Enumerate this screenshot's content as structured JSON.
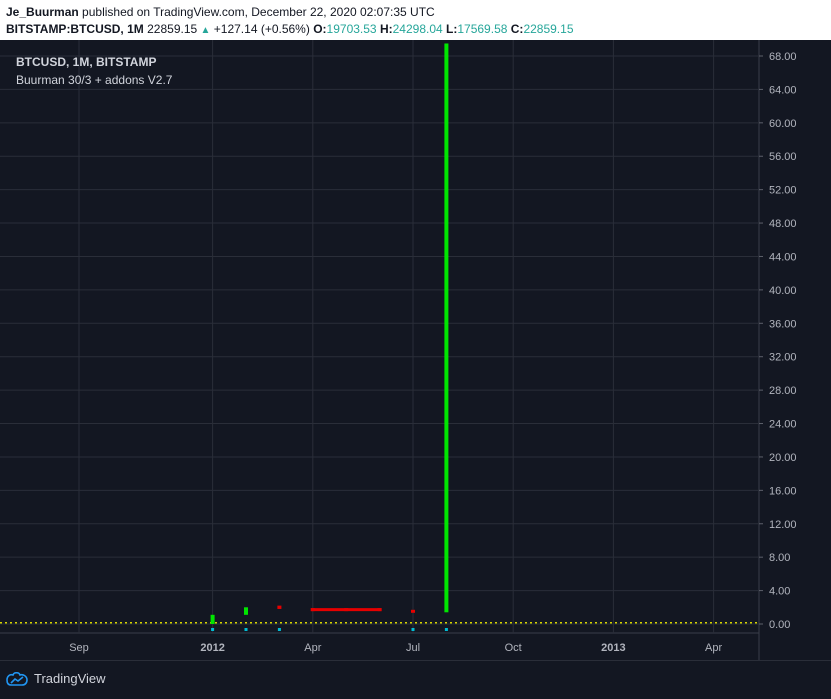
{
  "header": {
    "author": "Je_Buurman",
    "published_text": "published on TradingView.com, December 22, 2020 02:07:35 UTC",
    "symbol": "BITSTAMP:BTCUSD, 1M",
    "price": "22859.15",
    "change": "+127.14 (+0.56%)",
    "o_label": "O:",
    "o_value": "19703.53",
    "h_label": "H:",
    "h_value": "24298.04",
    "l_label": "L:",
    "l_value": "17569.58",
    "c_label": "C:",
    "c_value": "22859.15"
  },
  "legend": {
    "symbol_line": "BTCUSD, 1M, BITSTAMP",
    "indicator": "Buurman 30/3 + addons V2.7"
  },
  "footer": {
    "brand": "TradingView"
  },
  "colors": {
    "background": "#131722",
    "grid": "#2a2e39",
    "bull": "#00e600",
    "bear": "#e60000",
    "dotted_line": "#d4d400",
    "cyan": "#00bcd4"
  },
  "chart_data": {
    "type": "bar",
    "title": "",
    "ylim": [
      -0.8,
      69.5
    ],
    "y_ticks": [
      "68.00",
      "64.00",
      "60.00",
      "56.00",
      "52.00",
      "48.00",
      "44.00",
      "40.00",
      "36.00",
      "32.00",
      "28.00",
      "24.00",
      "20.00",
      "16.00",
      "12.00",
      "8.00",
      "4.00",
      "0.00"
    ],
    "y_tick_values": [
      68,
      64,
      60,
      56,
      52,
      48,
      44,
      40,
      36,
      32,
      28,
      24,
      20,
      16,
      12,
      8,
      4,
      0
    ],
    "x_ticks": [
      {
        "label": "Sep",
        "bold": false,
        "month": 0
      },
      {
        "label": "2012",
        "bold": true,
        "month": 4
      },
      {
        "label": "Apr",
        "bold": false,
        "month": 7
      },
      {
        "label": "Jul",
        "bold": false,
        "month": 10
      },
      {
        "label": "Oct",
        "bold": false,
        "month": 13
      },
      {
        "label": "2013",
        "bold": true,
        "month": 16
      },
      {
        "label": "Apr",
        "bold": false,
        "month": 19
      }
    ],
    "bars": [
      {
        "month": 4,
        "low": 0.0,
        "high": 1.1,
        "dir": "up"
      },
      {
        "month": 5,
        "low": 1.1,
        "high": 2.0,
        "dir": "up"
      },
      {
        "month": 6,
        "low": 1.8,
        "high": 2.2,
        "dir": "down"
      },
      {
        "month": 7,
        "low": 1.6,
        "high": 1.9,
        "dir": "down"
      },
      {
        "month": 8,
        "low": 1.6,
        "high": 1.9,
        "dir": "down"
      },
      {
        "month": 9,
        "low": 1.6,
        "high": 1.9,
        "dir": "down"
      },
      {
        "month": 10,
        "low": 1.5,
        "high": 1.7,
        "dir": "down"
      },
      {
        "month": 11,
        "low": 1.4,
        "high": 69.5,
        "dir": "up"
      }
    ],
    "cyan_marks": [
      4,
      5,
      6,
      10,
      11
    ],
    "dotted_level": 0.15
  }
}
